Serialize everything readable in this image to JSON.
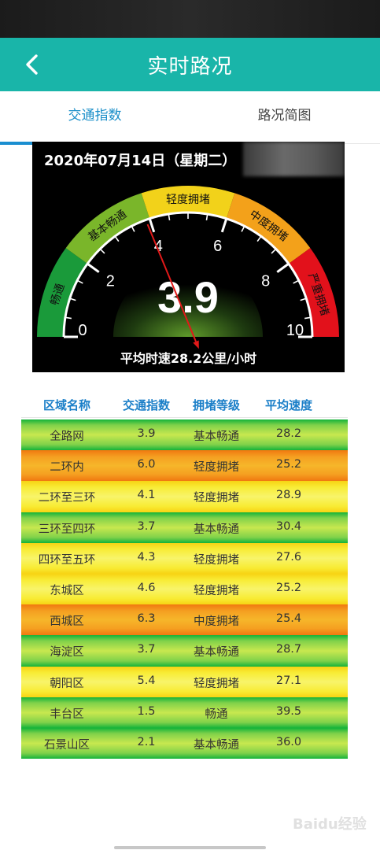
{
  "header": {
    "title": "实时路况",
    "back_icon": "chevron-left-icon"
  },
  "tabs": [
    {
      "label": "交通指数",
      "active": true
    },
    {
      "label": "路况简图",
      "active": false
    }
  ],
  "gauge": {
    "date": "2020年07月14日（星期二）",
    "value": "3.9",
    "needle_value": 3.9,
    "min": 0,
    "max": 10,
    "ticks": [
      "0",
      "2",
      "4",
      "6",
      "8",
      "10"
    ],
    "bands": [
      "畅通",
      "基本畅通",
      "轻度拥堵",
      "中度拥堵",
      "严重拥堵"
    ],
    "band_colors": [
      "#1a9a3a",
      "#7ab62a",
      "#f2d21a",
      "#f3a11a",
      "#e2111b"
    ],
    "average_speed": "平均时速28.2公里/小时"
  },
  "table": {
    "headers": [
      "区域名称",
      "交通指数",
      "拥堵等级",
      "平均速度"
    ],
    "rows": [
      {
        "cells": [
          "全路网",
          "3.9",
          "基本畅通",
          "28.2"
        ],
        "color": "green"
      },
      {
        "cells": [
          "二环内",
          "6.0",
          "轻度拥堵",
          "25.2"
        ],
        "color": "orange"
      },
      {
        "cells": [
          "二环至三环",
          "4.1",
          "轻度拥堵",
          "28.9"
        ],
        "color": "yellow"
      },
      {
        "cells": [
          "三环至四环",
          "3.7",
          "基本畅通",
          "30.4"
        ],
        "color": "green"
      },
      {
        "cells": [
          "四环至五环",
          "4.3",
          "轻度拥堵",
          "27.6"
        ],
        "color": "yellow"
      },
      {
        "cells": [
          "东城区",
          "4.6",
          "轻度拥堵",
          "25.2"
        ],
        "color": "yellow"
      },
      {
        "cells": [
          "西城区",
          "6.3",
          "中度拥堵",
          "25.4"
        ],
        "color": "orange"
      },
      {
        "cells": [
          "海淀区",
          "3.7",
          "基本畅通",
          "28.7"
        ],
        "color": "green"
      },
      {
        "cells": [
          "朝阳区",
          "5.4",
          "轻度拥堵",
          "27.1"
        ],
        "color": "yellow"
      },
      {
        "cells": [
          "丰台区",
          "1.5",
          "畅通",
          "39.5"
        ],
        "color": "green"
      },
      {
        "cells": [
          "石景山区",
          "2.1",
          "基本畅通",
          "36.0"
        ],
        "color": "green"
      }
    ]
  },
  "watermark": "Baidu经验"
}
